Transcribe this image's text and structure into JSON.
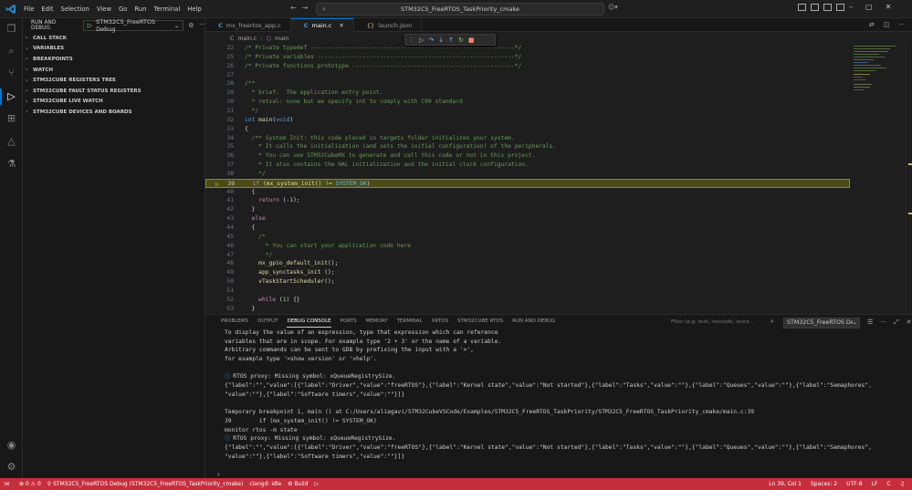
{
  "menu": [
    "File",
    "Edit",
    "Selection",
    "View",
    "Go",
    "Run",
    "Terminal",
    "Help"
  ],
  "command_center": "STM32C5_FreeRTOS_TaskPriority_cmake",
  "sidebar": {
    "title": "RUN AND DEBUG",
    "config": "STM32C5_FreeRTOS Debug",
    "sections": [
      "CALL STACK",
      "VARIABLES",
      "BREAKPOINTS",
      "WATCH",
      "STM32CUBE REGISTERS TREE",
      "STM32CUBE FAULT STATUS REGISTERS",
      "STM32CUBE LIVE WATCH",
      "STM32CUBE DEVICES AND BOARDS"
    ]
  },
  "tabs": [
    {
      "label": "mx_freertos_app.c",
      "icon": "C"
    },
    {
      "label": "main.c",
      "icon": "C"
    },
    {
      "label": "launch.json",
      "icon": "{}"
    }
  ],
  "breadcrumb": {
    "file": "main.c",
    "symbol": "main"
  },
  "code": [
    {
      "n": "22",
      "t": "/* Private typedef -----------------------------------------------------------*/"
    },
    {
      "n": "25",
      "t": "/* Private variables ---------------------------------------------------------*/"
    },
    {
      "n": "26",
      "t": "/* Private functions prototype -----------------------------------------------*/"
    },
    {
      "n": "27",
      "t": ""
    },
    {
      "n": "28",
      "t": "/**"
    },
    {
      "n": "29",
      "t": "  * brief:  The application entry point."
    },
    {
      "n": "30",
      "t": "  * retval: none but we specify int to comply with C99 standard"
    },
    {
      "n": "31",
      "t": "  */"
    },
    {
      "n": "32",
      "t": "int main(void)"
    },
    {
      "n": "33",
      "t": "{"
    },
    {
      "n": "34",
      "t": "  /** System Init: this code placed in targets folder initializes your system."
    },
    {
      "n": "35",
      "t": "    * It calls the initialization (and sets the initial configuration) of the peripherals."
    },
    {
      "n": "36",
      "t": "    * You can use STM32CubeMX to generate and call this code or not in this project."
    },
    {
      "n": "37",
      "t": "    * It also contains the HAL initialization and the initial clock configuration."
    },
    {
      "n": "38",
      "t": "    */"
    },
    {
      "n": "39",
      "t": "  if (mx_system_init() != SYSTEM_OK)"
    },
    {
      "n": "40",
      "t": "  {"
    },
    {
      "n": "41",
      "t": "    return (-1);"
    },
    {
      "n": "42",
      "t": "  }"
    },
    {
      "n": "43",
      "t": "  else"
    },
    {
      "n": "44",
      "t": "  {"
    },
    {
      "n": "45",
      "t": "    /*"
    },
    {
      "n": "46",
      "t": "      * You can start your application code here"
    },
    {
      "n": "47",
      "t": "      */"
    },
    {
      "n": "48",
      "t": "    mx_gpio_default_init();"
    },
    {
      "n": "49",
      "t": "    app_synctasks_init ();"
    },
    {
      "n": "50",
      "t": "    vTaskStartScheduler();"
    },
    {
      "n": "51",
      "t": ""
    },
    {
      "n": "52",
      "t": "    while (1) {}"
    },
    {
      "n": "53",
      "t": "  }"
    }
  ],
  "panel": {
    "tabs": [
      "PROBLEMS",
      "OUTPUT",
      "DEBUG CONSOLE",
      "PORTS",
      "MEMORY",
      "TERMINAL",
      "XRTOS",
      "STM32CUBE RTOS",
      "RUN AND DEBUG"
    ],
    "active_tab": "DEBUG CONSOLE",
    "filter_placeholder": "Filter (e.g. text, !exclude, \\esca...",
    "session": "STM32C5_FreeRTOS De"
  },
  "console": [
    "To display the value of an expression, type that expression which can reference",
    "variables that are in scope. For example type '2 + 3' or the name of a variable.",
    "Arbitrary commands can be sent to GDB by prefixing the input with a '>',",
    "for example type '>show version' or '>help'.",
    "",
    "RTOS proxy: Missing symbol: xQueueRegistrySize.",
    "{\"label\":\"\",\"value\":[{\"label\":\"Driver\",\"value\":\"freeRTOS\"},{\"label\":\"Kernel state\",\"value\":\"Not started\"},{\"label\":\"Tasks\",\"value\":\"\"},{\"label\":\"Queues\",\"value\":\"\"},{\"label\":\"Semaphores\",",
    "\"value\":\"\"},{\"label\":\"Software timers\",\"value\":\"\"}]}",
    "",
    "Temporary breakpoint 1, main () at C:/Users/aliagavi/STM32CubeVSCode/Examples/STM32C5_FreeRTOS_TaskPriority/STM32C5_FreeRTOS_TaskPriority_cmake/main.c:39",
    "39        if (mx_system_init() != SYSTEM_OK)",
    "monitor rtos -m state",
    "RTOS proxy: Missing symbol: xQueueRegistrySize.",
    "{\"label\":\"\",\"value\":[{\"label\":\"Driver\",\"value\":\"freeRTOS\"},{\"label\":\"Kernel state\",\"value\":\"Not started\"},{\"label\":\"Tasks\",\"value\":\"\"},{\"label\":\"Queues\",\"value\":\"\"},{\"label\":\"Semaphores\",",
    "\"value\":\"\"},{\"label\":\"Software timers\",\"value\":\"\"}]}"
  ],
  "status": {
    "errors": "0",
    "warnings": "0",
    "debug": "STM32C5_FreeRTOS Debug (STM32C5_FreeRTOS_TaskPriority_cmake)",
    "clangd": "clangd: idle",
    "build": "Build",
    "position": "Ln 39, Col 1",
    "spaces": "Spaces: 2",
    "encoding": "UTF-8",
    "eol": "LF",
    "language": "C",
    "bar_color": "#c72e3c"
  }
}
